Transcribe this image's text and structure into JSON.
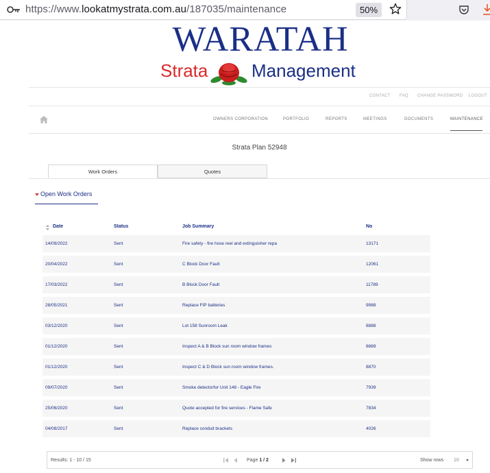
{
  "browser": {
    "url_prefix": "https://www.",
    "url_host": "lookatmystrata.com.au",
    "url_path": "/187035/maintenance",
    "zoom": "50%"
  },
  "logo": {
    "title": "WARATAH",
    "strata": "Strata",
    "management": "Management"
  },
  "top_links": [
    "CONTACT",
    "FAQ",
    "CHANGE PASSWORD",
    "LOGOUT"
  ],
  "nav": {
    "items": [
      "OWNERS CORPORATION",
      "PORTFOLIO",
      "REPORTS",
      "MEETINGS",
      "DOCUMENTS",
      "MAINTENANCE"
    ],
    "active": "MAINTENANCE"
  },
  "plan_title": "Strata Plan 52948",
  "tabs": [
    "Work Orders",
    "Quotes"
  ],
  "section_title": "Open Work Orders",
  "table": {
    "headers": [
      "Date",
      "Status",
      "Job Summary",
      "No"
    ],
    "rows": [
      [
        "14/09/2022",
        "Sent",
        "Fire safety - fire hose reel and extinguisher repa",
        "13171"
      ],
      [
        "20/04/2022",
        "Sent",
        "C Block Door Fault",
        "12061"
      ],
      [
        "17/03/2022",
        "Sent",
        "B Block Door Fault",
        "11789"
      ],
      [
        "28/05/2021",
        "Sent",
        "Replace FIP batteries",
        "9988"
      ],
      [
        "03/12/2020",
        "Sent",
        "Lot 158 Sunroom Leak",
        "8888"
      ],
      [
        "01/12/2020",
        "Sent",
        "Inspect A & B Block sun room window frames",
        "8869"
      ],
      [
        "01/12/2020",
        "Sent",
        "Inspect C & D Block sun room window frames.",
        "8870"
      ],
      [
        "09/07/2020",
        "Sent",
        "Smoke detectorfor Unit 148 - Eagle Fire",
        "7939"
      ],
      [
        "25/06/2020",
        "Sent",
        "Quote accepted for fire services - Flame Safe",
        "7834"
      ],
      [
        "04/08/2017",
        "Sent",
        "Replace conduit brackets",
        "4026"
      ]
    ]
  },
  "pager": {
    "results": "Results: 1 - 10 / 15",
    "page_label": "Page",
    "page_value": "1 / 2",
    "show_rows_label": "Show rows",
    "show_rows_value": "10"
  },
  "colors": {
    "brand_blue": "#1b2f86",
    "brand_red": "#d92a2a",
    "row_bg": "#f5f5f5"
  }
}
